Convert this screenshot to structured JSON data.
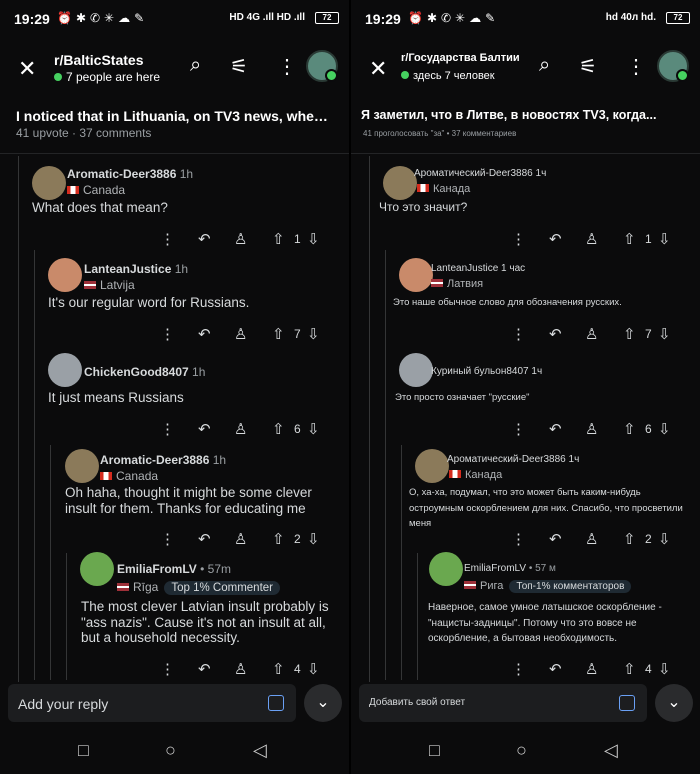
{
  "status": {
    "time": "19:29",
    "battery": "72"
  },
  "left": {
    "net": "HD 4G .ıll HD .ıll",
    "header": {
      "subreddit": "r/BalticStates",
      "online": "7 people are here"
    },
    "post": {
      "title": "I noticed that in Lithuania, on TV3 news, when the...",
      "meta": "41 upvote · 37 comments"
    },
    "comments": [
      {
        "user": "Aromatic-Deer3886",
        "time": "1h",
        "flair": "Canada",
        "text": "What does that mean?",
        "votes": "1"
      },
      {
        "user": "LanteanJustice",
        "time": "1h",
        "flair": "Latvija",
        "text": "It's our regular word for Russians.",
        "votes": "7"
      },
      {
        "user": "ChickenGood8407",
        "time": "1h",
        "text": "It just means Russians",
        "votes": "6"
      },
      {
        "user": "Aromatic-Deer3886",
        "time": "1h",
        "flair": "Canada",
        "text": "Oh haha, thought it might be some clever insult for them. Thanks for educating me",
        "votes": "2"
      },
      {
        "user": "EmiliaFromLV",
        "time": " • 57m",
        "flair": "Rīga",
        "badge": "Top 1% Commenter",
        "text": "The most clever Latvian insult probably is \"ass nazis\". Cause it's not an insult at all, but a household necessity.",
        "votes": "4"
      }
    ],
    "reply": "Add your reply"
  },
  "right": {
    "net": "hd 40л hd.",
    "header": {
      "subreddit": "r/Государства Балтии",
      "online": "здесь 7 человек"
    },
    "post": {
      "title": "Я заметил, что в Литве, в новостях TV3, когда...",
      "meta": "41 проголосовать \"за\" • 37 комментариев"
    },
    "comments": [
      {
        "user": "Ароматический-Deer3886 1ч",
        "time": "",
        "flair": "Канада",
        "text": "Что это значит?",
        "votes": "1"
      },
      {
        "user": "LanteanJustice 1 час",
        "time": "",
        "flair": "Латвия",
        "text": "Это наше обычное слово для обозначения русских.",
        "votes": "7"
      },
      {
        "user": "Куриный бульон8407 1ч",
        "time": "",
        "text": "Это просто означает \"русские\"",
        "votes": "6"
      },
      {
        "user": "Ароматический-Deer3886 1ч",
        "time": "",
        "flair": "Канада",
        "text": "О, ха-ха, подумал, что это может быть каким-нибудь остроумным оскорблением для них. Спасибо, что просветили меня",
        "votes": "2"
      },
      {
        "user": "EmiliaFromLV",
        "time": " • 57 м",
        "flair": "Рига",
        "badge": "Топ-1% комментаторов",
        "text": "Наверное, самое умное латышское оскорбление - \"нацисты-задницы\". Потому что это вовсе не оскорбление, а бытовая необходимость.",
        "votes": "4"
      }
    ],
    "reply": "Добавить свой ответ"
  }
}
